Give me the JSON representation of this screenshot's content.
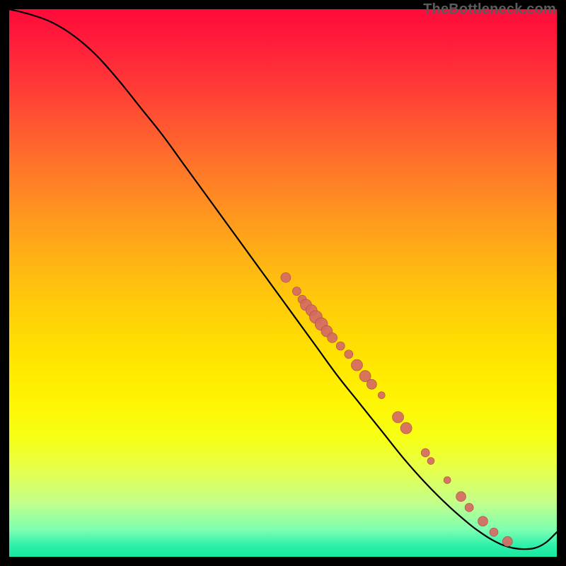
{
  "watermark": "TheBottleneck.com",
  "colors": {
    "curve_stroke": "#000000",
    "dot_fill": "#d46a63",
    "dot_stroke": "#ad4a44"
  },
  "chart_data": {
    "type": "line",
    "title": "",
    "xlabel": "",
    "ylabel": "",
    "xlim": [
      0,
      100
    ],
    "ylim": [
      0,
      100
    ],
    "series": [
      {
        "name": "bottleneck-curve",
        "x": [
          0,
          4,
          8,
          12,
          16,
          20,
          24,
          28,
          32,
          36,
          40,
          44,
          48,
          52,
          56,
          60,
          64,
          68,
          72,
          76,
          80,
          84,
          86,
          88,
          90,
          92,
          94,
          96,
          98,
          100
        ],
        "y": [
          100,
          99,
          97.5,
          95,
          91.5,
          87,
          82,
          77,
          71.5,
          66,
          60.5,
          55,
          49.5,
          44,
          38.5,
          33,
          28,
          23,
          18,
          13.5,
          9.5,
          6,
          4.5,
          3.2,
          2.2,
          1.6,
          1.4,
          1.6,
          2.6,
          4.5
        ]
      }
    ],
    "scatter": [
      {
        "x": 50.5,
        "y": 51.0,
        "r": 7
      },
      {
        "x": 52.5,
        "y": 48.5,
        "r": 6
      },
      {
        "x": 53.5,
        "y": 47.0,
        "r": 6
      },
      {
        "x": 54.2,
        "y": 46.0,
        "r": 8
      },
      {
        "x": 55.2,
        "y": 45.0,
        "r": 8
      },
      {
        "x": 56.0,
        "y": 43.8,
        "r": 9
      },
      {
        "x": 57.0,
        "y": 42.5,
        "r": 9
      },
      {
        "x": 58.0,
        "y": 41.2,
        "r": 8
      },
      {
        "x": 59.0,
        "y": 40.0,
        "r": 7
      },
      {
        "x": 60.5,
        "y": 38.5,
        "r": 6
      },
      {
        "x": 62.0,
        "y": 37.0,
        "r": 6
      },
      {
        "x": 63.5,
        "y": 35.0,
        "r": 8
      },
      {
        "x": 65.0,
        "y": 33.0,
        "r": 8
      },
      {
        "x": 66.2,
        "y": 31.5,
        "r": 7
      },
      {
        "x": 68.0,
        "y": 29.5,
        "r": 5
      },
      {
        "x": 71.0,
        "y": 25.5,
        "r": 8
      },
      {
        "x": 72.5,
        "y": 23.5,
        "r": 8
      },
      {
        "x": 76.0,
        "y": 19.0,
        "r": 6
      },
      {
        "x": 77.0,
        "y": 17.5,
        "r": 5
      },
      {
        "x": 80.0,
        "y": 14.0,
        "r": 5
      },
      {
        "x": 82.5,
        "y": 11.0,
        "r": 7
      },
      {
        "x": 84.0,
        "y": 9.0,
        "r": 6
      },
      {
        "x": 86.5,
        "y": 6.5,
        "r": 7
      },
      {
        "x": 88.5,
        "y": 4.5,
        "r": 6
      },
      {
        "x": 91.0,
        "y": 2.8,
        "r": 7
      }
    ]
  }
}
